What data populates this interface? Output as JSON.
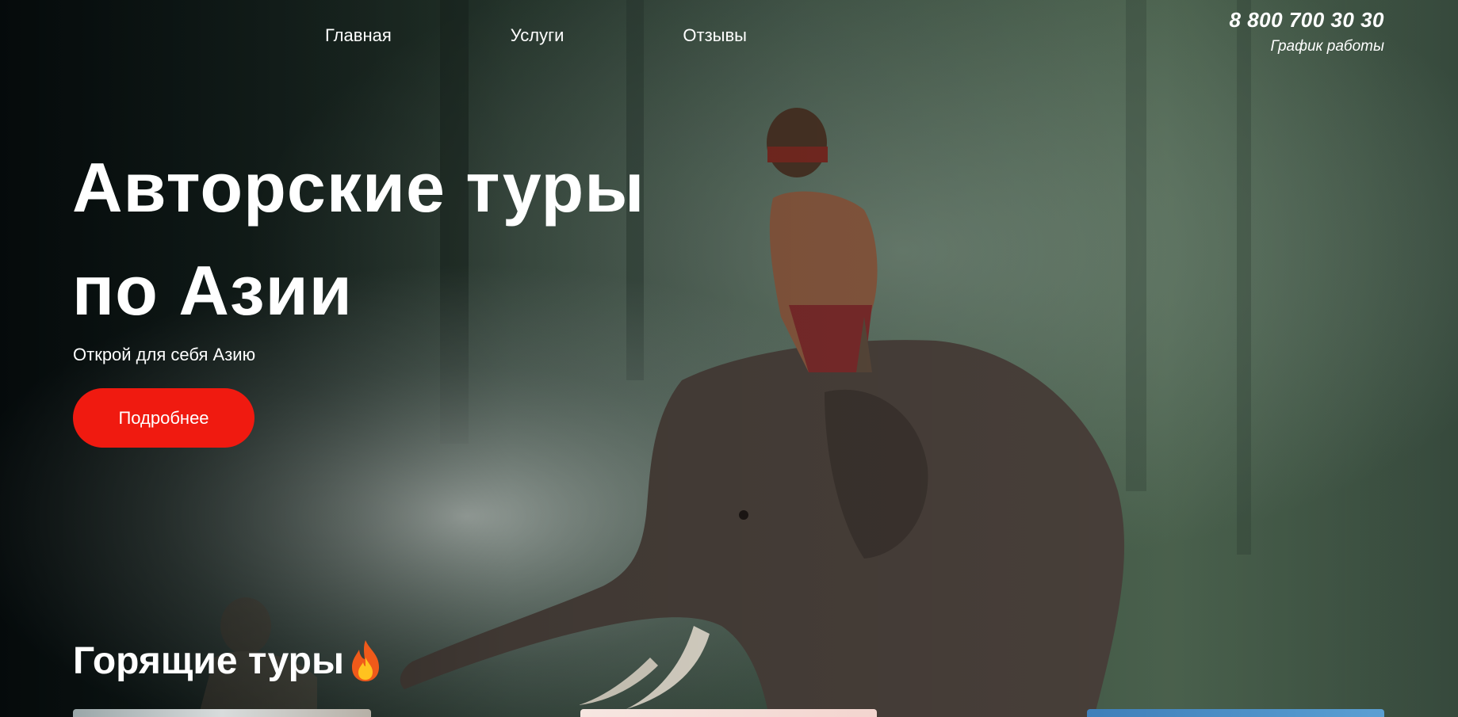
{
  "nav": {
    "items": [
      "Главная",
      "Услуги",
      "Отзывы"
    ]
  },
  "contact": {
    "phone": "8 800 700 30 30",
    "hours_link": "График работы"
  },
  "hero": {
    "title_line1": "Авторские туры",
    "title_line2": "по Азии",
    "subtitle": "Открой для себя Азию",
    "cta_label": "Подробнее",
    "background_icon": "elephant-rider-photo"
  },
  "hot_tours": {
    "title": "Горящие туры",
    "icon": "fire-icon"
  },
  "colors": {
    "accent": "#f01a10",
    "text": "#ffffff"
  }
}
